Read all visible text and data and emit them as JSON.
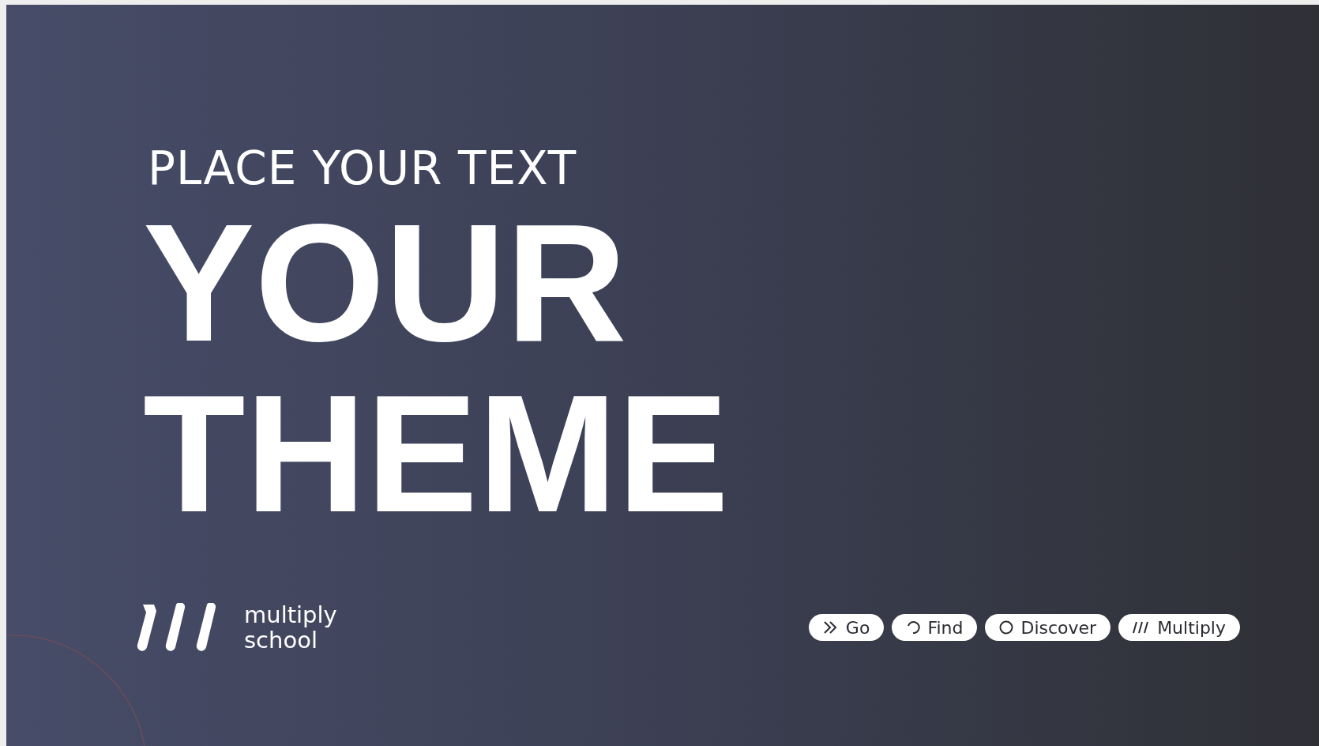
{
  "slide": {
    "kicker": "PLACE YOUR TEXT",
    "title_lines": [
      "YOUR",
      "THEME"
    ],
    "logo": {
      "line_1": "multiply",
      "line_2": "school"
    },
    "tags": [
      {
        "kind": "chevrons",
        "label": "Go"
      },
      {
        "kind": "arc",
        "label": "Find"
      },
      {
        "kind": "circle",
        "label": "Discover"
      },
      {
        "kind": "slashes",
        "label": "Multiply"
      }
    ]
  }
}
